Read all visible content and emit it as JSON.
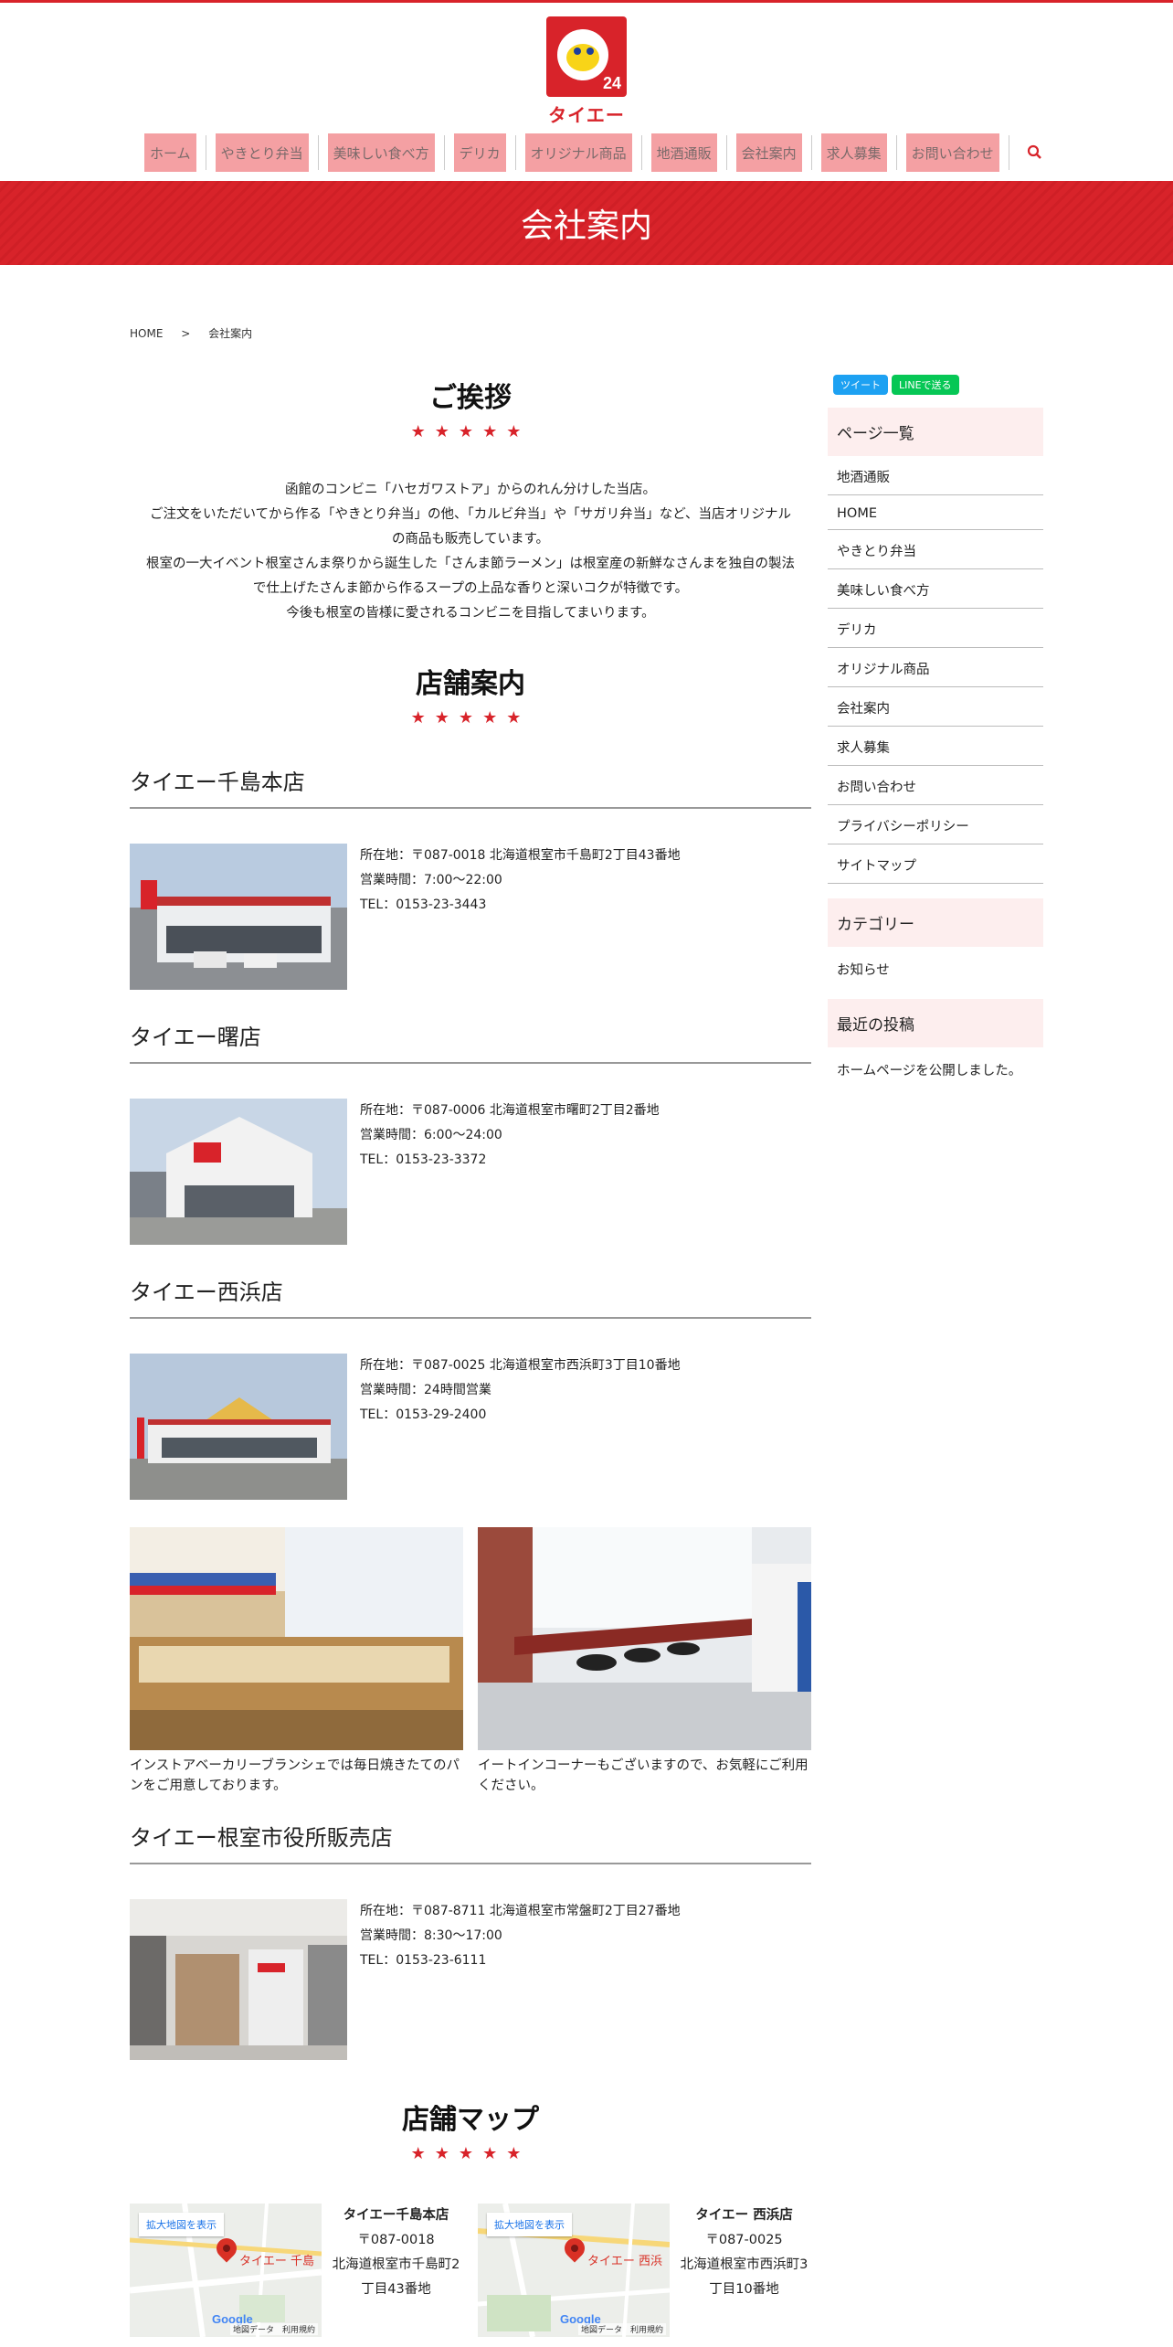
{
  "brand": {
    "logo_number": "24",
    "logo_text": "タイエー",
    "accent_color": "#d8232a"
  },
  "nav": {
    "items": [
      "ホーム",
      "やきとり弁当",
      "美味しい食べ方",
      "デリカ",
      "オリジナル商品",
      "地酒通販",
      "会社案内",
      "求人募集",
      "お問い合わせ"
    ],
    "search_icon": "search-icon"
  },
  "banner": {
    "title": "会社案内"
  },
  "breadcrumb": {
    "home": "HOME",
    "separator": ">",
    "current": "会社案内"
  },
  "greeting": {
    "title": "ご挨拶",
    "stars": "★★★★★",
    "lines": [
      "函館のコンビニ「ハセガワストア」からのれん分けした当店。",
      "ご注文をいただいてから作る「やきとり弁当」の他、「カルビ弁当」や「サガリ弁当」など、当店オリジナル",
      "の商品も販売しています。",
      "根室の一大イベント根室さんま祭りから誕生した「さんま節ラーメン」は根室産の新鮮なさんまを独自の製法",
      "で仕上げたさんま節から作るスープの上品な香りと深いコクが特徴です。",
      "今後も根室の皆様に愛されるコンビニを目指してまいります。"
    ]
  },
  "stores_section": {
    "title": "店舗案内",
    "stars": "★★★★★",
    "stores": [
      {
        "name": "タイエー千島本店",
        "address": "所在地：〒087-0018 北海道根室市千島町2丁目43番地",
        "hours": "営業時間：7:00～22:00",
        "tel": "TEL：0153-23-3443"
      },
      {
        "name": "タイエー曙店",
        "address": "所在地：〒087-0006 北海道根室市曙町2丁目2番地",
        "hours": "営業時間：6:00～24:00",
        "tel": "TEL：0153-23-3372"
      },
      {
        "name": "タイエー西浜店",
        "address": "所在地：〒087-0025 北海道根室市西浜町3丁目10番地",
        "hours": "営業時間：24時間営業",
        "tel": "TEL：0153-29-2400"
      }
    ],
    "photos": [
      {
        "caption": "インストアベーカリーブランシェでは毎日焼きたてのパンをご用意しております。"
      },
      {
        "caption": "イートインコーナーもございますので、お気軽にご利用ください。"
      }
    ],
    "store4": {
      "name": "タイエー根室市役所販売店",
      "address": "所在地：〒087-8711 北海道根室市常盤町2丁目27番地",
      "hours": "営業時間：8:30～17:00",
      "tel": "TEL：0153-23-6111"
    }
  },
  "map_section": {
    "title": "店舗マップ",
    "stars": "★★★★★",
    "maps": [
      {
        "link": "拡大地図を表示",
        "pin_label": "タイエー 千島",
        "name": "タイエー千島本店",
        "line1": "〒087-0018",
        "line2": "北海道根室市千島町2",
        "line3": "丁目43番地",
        "footer": "地図データ　利用規約"
      },
      {
        "link": "拡大地図を表示",
        "pin_label": "タイエー 西浜",
        "name": "タイエー 西浜店",
        "line1": "〒087-0025",
        "line2": "北海道根室市西浜町3",
        "line3": "丁目10番地",
        "footer": "地図データ　利用規約"
      }
    ]
  },
  "sidebar": {
    "tweet": "ツイート",
    "line": "LINEで送る",
    "pages_title": "ページ一覧",
    "pages": [
      "地酒通販",
      "HOME",
      "やきとり弁当",
      "美味しい食べ方",
      "デリカ",
      "オリジナル商品",
      "会社案内",
      "求人募集",
      "お問い合わせ",
      "プライバシーポリシー",
      "サイトマップ"
    ],
    "category_title": "カテゴリー",
    "category": "お知らせ",
    "recent_title": "最近の投稿",
    "recent": "ホームページを公開しました。"
  }
}
